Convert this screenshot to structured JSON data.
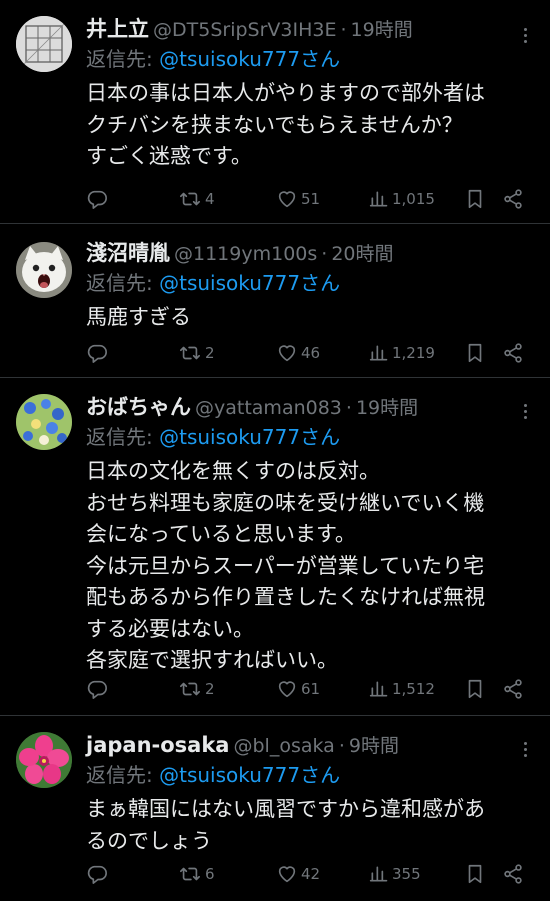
{
  "reply_prefix": "返信先: ",
  "tweets": [
    {
      "name": "井上立",
      "handle": "@DT5SripSrV3IH3E",
      "sep": "·",
      "time": "19時間",
      "reply_to": "@tsuisoku777さん",
      "text": "日本の事は日本人がやりますので部外者は\nクチバシを挟まないでもらえませんか？\nすごく迷惑です。",
      "retweets": "4",
      "likes": "51",
      "views": "1,015"
    },
    {
      "name": "淺沼晴胤",
      "handle": "@1119ym100s",
      "sep": "·",
      "time": "20時間",
      "reply_to": "@tsuisoku777さん",
      "text": "馬鹿すぎる",
      "retweets": "2",
      "likes": "46",
      "views": "1,219"
    },
    {
      "name": "おばちゃん",
      "handle": "@yattaman083",
      "sep": "·",
      "time": "19時間",
      "reply_to": "@tsuisoku777さん",
      "text": "日本の文化を無くすのは反対。\nおせち料理も家庭の味を受け継いでいく機\n会になっていると思います。\n今は元旦からスーパーが営業していたり宅\n配もあるから作り置きしたくなければ無視\nする必要はない。\n各家庭で選択すればいい。",
      "retweets": "2",
      "likes": "61",
      "views": "1,512"
    },
    {
      "name": "japan-osaka",
      "handle": "@bl_osaka",
      "sep": "·",
      "time": "9時間",
      "reply_to": "@tsuisoku777さん",
      "text": "まぁ韓国にはない風習ですから違和感があ\nるのでしょう",
      "retweets": "6",
      "likes": "42",
      "views": "355"
    }
  ],
  "colors": {
    "background": "#000000",
    "text": "#e7e9ea",
    "secondary": "#71767b",
    "link": "#1d9bf0",
    "divider": "#2f3336"
  }
}
